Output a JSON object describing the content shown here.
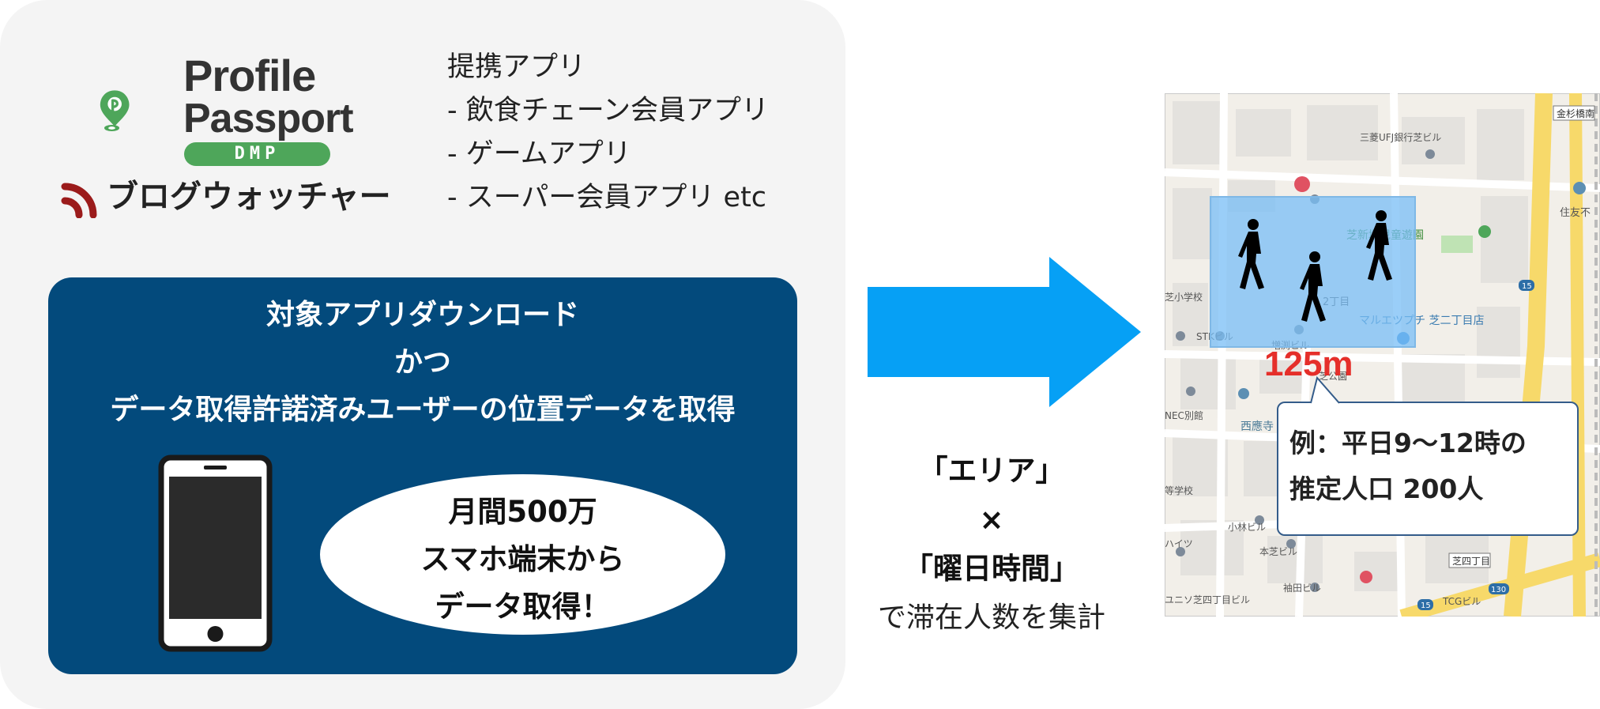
{
  "logos": {
    "profile_passport_line1": "Profile",
    "profile_passport_line2": "Passport",
    "dmp_badge": "DMP",
    "blogwatcher": "ブログウォッチャー",
    "brand_green": "#4ea65a",
    "brand_red": "#9b1b1b"
  },
  "partner_apps": {
    "heading": "提携アプリ",
    "items": [
      "- 飲食チェーン会員アプリ",
      "- ゲームアプリ",
      "- スーパー会員アプリ etc"
    ]
  },
  "data_box": {
    "line1": "対象アプリダウンロード",
    "line2": "かつ",
    "line3": "データ取得許諾済みユーザーの位置データを取得",
    "bubble": [
      "月間500万",
      "スマホ端末から",
      "データ取得！"
    ],
    "color": "#034a7c"
  },
  "arrow_color": "#06a0f5",
  "caption": {
    "line1": "「エリア」",
    "line2": "×",
    "line3": "「曜日時間」",
    "line4": "で滞在人数を集計"
  },
  "map": {
    "distance_label": "125m",
    "callout": [
      "例：平日9〜12時の",
      "推定人口 200人"
    ],
    "place_labels": [
      "金杉橋南",
      "三菱UFJ銀行芝ビル",
      "住友不",
      "芝新堀児童遊園",
      "2丁目",
      "芝小学校",
      "STKビル",
      "マルエツプチ 芝二丁目店",
      "増渕ビル",
      "芝公園",
      "NEC別館",
      "西應寺",
      "等学校",
      "小林ビル",
      "本芝ビル",
      "ハイツ",
      "袖田ビル",
      "芝四丁目",
      "ユニソ芝四丁目ビル",
      "TCGビル",
      "15",
      "130"
    ]
  }
}
